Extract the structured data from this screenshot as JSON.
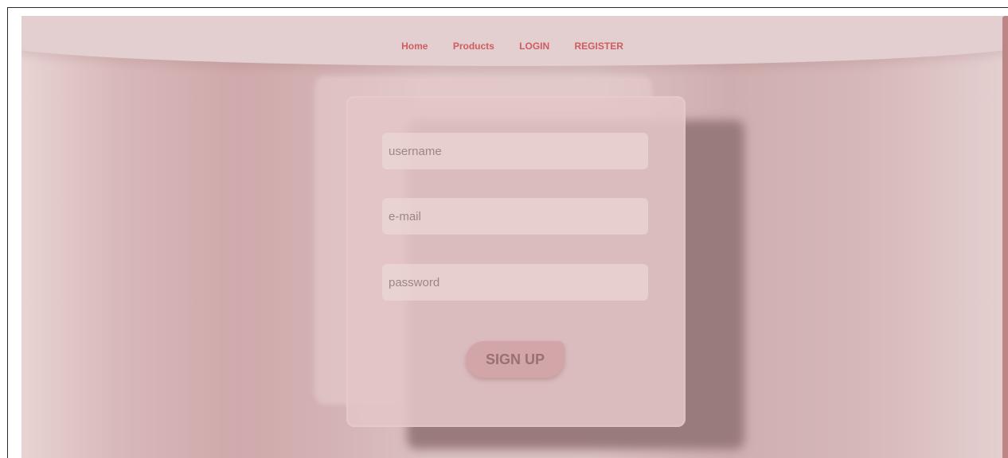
{
  "nav": {
    "items": [
      {
        "label": "Home"
      },
      {
        "label": "Products"
      },
      {
        "label": "LOGIN"
      },
      {
        "label": "REGISTER"
      }
    ]
  },
  "form": {
    "username": {
      "placeholder": "username",
      "value": ""
    },
    "email": {
      "placeholder": "e-mail",
      "value": ""
    },
    "password": {
      "placeholder": "password",
      "value": ""
    },
    "submit_label": "SIGN UP"
  },
  "colors": {
    "accent": "#cf5c60",
    "button_bg": "#d2a6a8",
    "button_text": "#9b7073",
    "scrollbar": "#bc8686"
  }
}
